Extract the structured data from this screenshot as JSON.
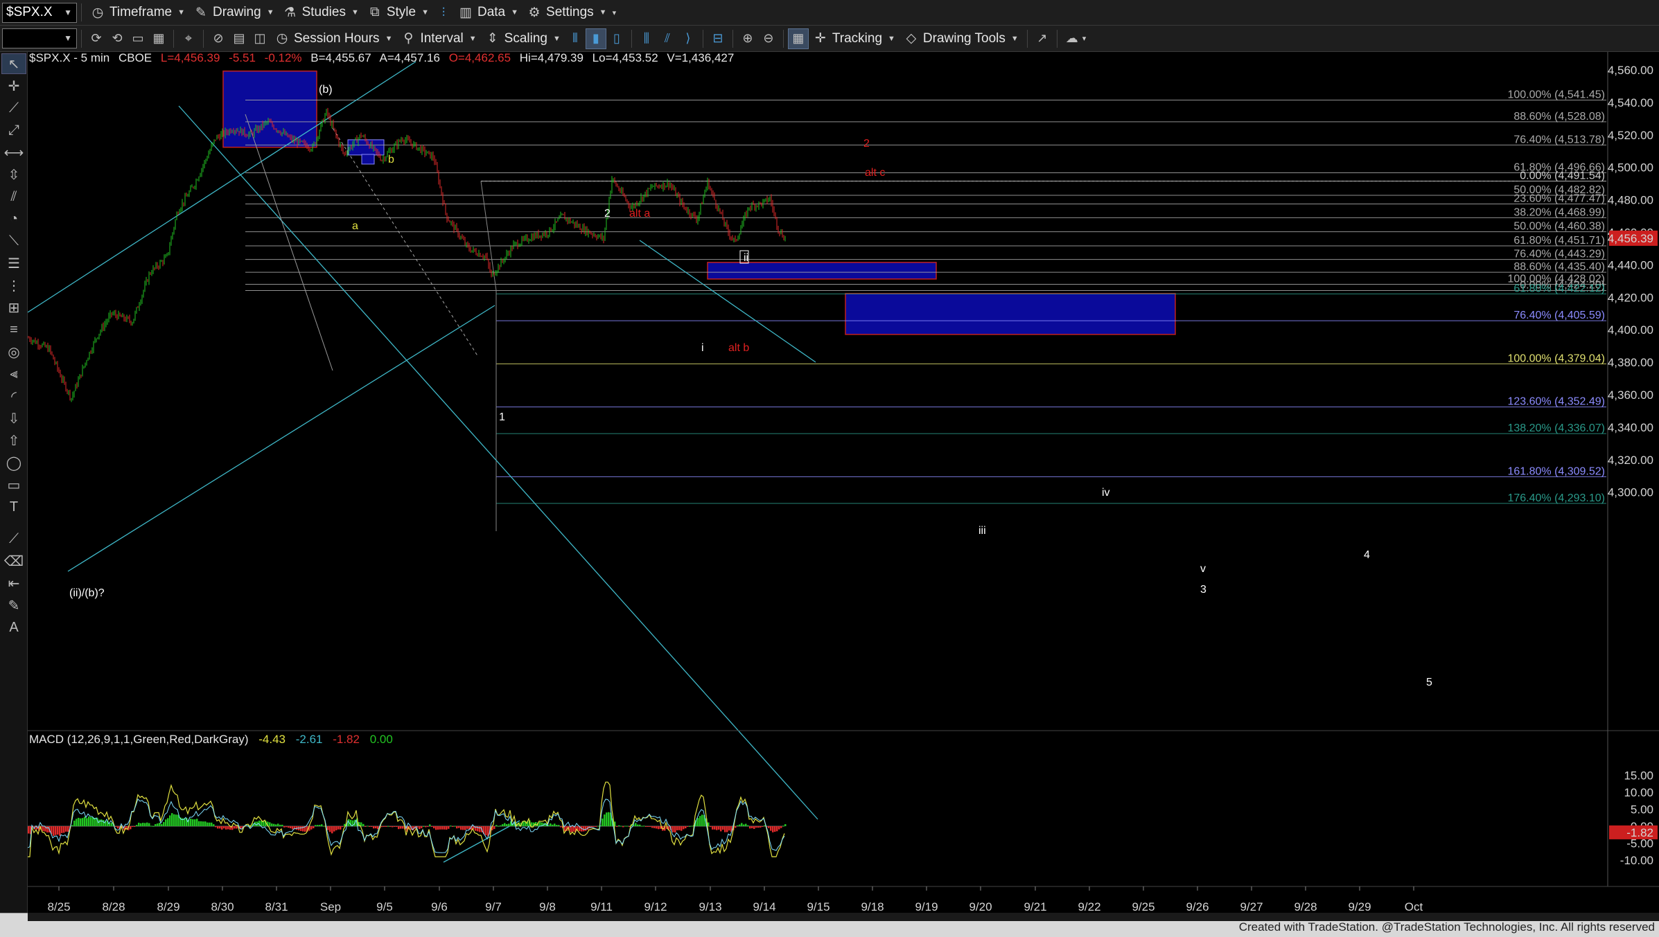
{
  "toolbar1": {
    "symbol": "$SPX.X",
    "items": [
      "Timeframe",
      "Drawing",
      "Studies",
      "Style",
      "Data",
      "Settings"
    ]
  },
  "toolbar2": {
    "items": [
      "Session Hours",
      "Interval",
      "Scaling",
      "Tracking",
      "Drawing Tools"
    ]
  },
  "chart": {
    "header": {
      "symbol": "$SPX.X - 5 min",
      "exchange": "CBOE",
      "last": "L=4,456.39",
      "change": "-5.51",
      "change_pct": "-0.12%",
      "bid": "B=4,455.67",
      "ask": "A=4,457.16",
      "open": "O=4,462.65",
      "high": "Hi=4,479.39",
      "low": "Lo=4,453.52",
      "volume": "V=1,436,427"
    },
    "price_axis": [
      "4,560.00",
      "4,540.00",
      "4,520.00",
      "4,500.00",
      "4,480.00",
      "4,460.00",
      "4,440.00",
      "4,420.00",
      "4,400.00",
      "4,380.00",
      "4,360.00",
      "4,340.00",
      "4,320.00",
      "4,300.00"
    ],
    "last_price_tag": "4,456.39",
    "date_axis": [
      "8/25",
      "8/28",
      "8/29",
      "8/30",
      "8/31",
      "Sep",
      "9/5",
      "9/6",
      "9/7",
      "9/8",
      "9/11",
      "9/12",
      "9/13",
      "9/14",
      "9/15",
      "9/18",
      "9/19",
      "9/20",
      "9/21",
      "9/22",
      "9/25",
      "9/26",
      "9/27",
      "9/28",
      "9/29",
      "Oct"
    ],
    "fib_levels": [
      {
        "label": "100.00% (4,541.45)",
        "color": "#aaaaaa"
      },
      {
        "label": "88.60% (4,528.08)",
        "color": "#aaaaaa"
      },
      {
        "label": "76.40% (4,513.78)",
        "color": "#aaaaaa"
      },
      {
        "label": "61.80% (4,496.66)",
        "color": "#aaaaaa"
      },
      {
        "label": "0.00% (4,491.54)",
        "color": "#cccccc"
      },
      {
        "label": "50.00% (4,482.82)",
        "color": "#aaaaaa"
      },
      {
        "label": "23.60% (4,477.47)",
        "color": "#aaaaaa"
      },
      {
        "label": "38.20% (4,468.99)",
        "color": "#aaaaaa"
      },
      {
        "label": "50.00% (4,460.38)",
        "color": "#aaaaaa"
      },
      {
        "label": "61.80% (4,451.71)",
        "color": "#aaaaaa"
      },
      {
        "label": "76.40% (4,443.29)",
        "color": "#aaaaaa"
      },
      {
        "label": "88.60% (4,435.40)",
        "color": "#aaaaaa"
      },
      {
        "label": "100.00% (4,428.02)",
        "color": "#aaaaaa"
      },
      {
        "label": "0.00% (4,424.20)",
        "color": "#aaaaaa"
      },
      {
        "label": "61.80% (4,422.12)",
        "color": "#2a9a8a"
      },
      {
        "label": "76.40% (4,405.59)",
        "color": "#8c8cff"
      },
      {
        "label": "100.00% (4,379.04)",
        "color": "#e0e070"
      },
      {
        "label": "123.60% (4,352.49)",
        "color": "#8c8cff"
      },
      {
        "label": "138.20% (4,336.07)",
        "color": "#2a9a8a"
      },
      {
        "label": "161.80% (4,309.52)",
        "color": "#8c8cff"
      },
      {
        "label": "176.40% (4,293.10)",
        "color": "#2a9a8a"
      }
    ],
    "wave_labels": [
      {
        "text": "(b)",
        "color": "#ffffff"
      },
      {
        "text": "b",
        "color": "#e0e040"
      },
      {
        "text": "a",
        "color": "#e0e040"
      },
      {
        "text": "2",
        "color": "#ffffff"
      },
      {
        "text": "alt a",
        "color": "#e02020"
      },
      {
        "text": "2",
        "color": "#e02020"
      },
      {
        "text": "alt c",
        "color": "#e02020"
      },
      {
        "text": "ii",
        "color": "#ffffff"
      },
      {
        "text": "i",
        "color": "#ffffff"
      },
      {
        "text": "alt b",
        "color": "#e02020"
      },
      {
        "text": "1",
        "color": "#ffffff"
      },
      {
        "text": "(ii)/(b)?",
        "color": "#ffffff"
      },
      {
        "text": "iv",
        "color": "#ffffff"
      },
      {
        "text": "iii",
        "color": "#ffffff"
      },
      {
        "text": "4",
        "color": "#ffffff"
      },
      {
        "text": "v",
        "color": "#ffffff"
      },
      {
        "text": "3",
        "color": "#ffffff"
      },
      {
        "text": "5",
        "color": "#ffffff"
      }
    ]
  },
  "macd": {
    "title": "MACD (12,26,9,1,1,Green,Red,DarkGray)",
    "v1": "-4.43",
    "v2": "-2.61",
    "v3": "-1.82",
    "v4": "0.00",
    "axis": [
      "15.00",
      "10.00",
      "5.00",
      "0.00",
      "-5.00",
      "-10.00"
    ],
    "last_tag": "-1.82"
  },
  "footer": {
    "credit": "Created with TradeStation. @TradeStation Technologies, Inc. All rights reserved"
  },
  "colors": {
    "up_candle": "#22c422",
    "down_candle": "#e02a2a",
    "trendline": "#3fb8c8",
    "box_fill": "#0a0a9a",
    "box_border": "#c02020"
  }
}
